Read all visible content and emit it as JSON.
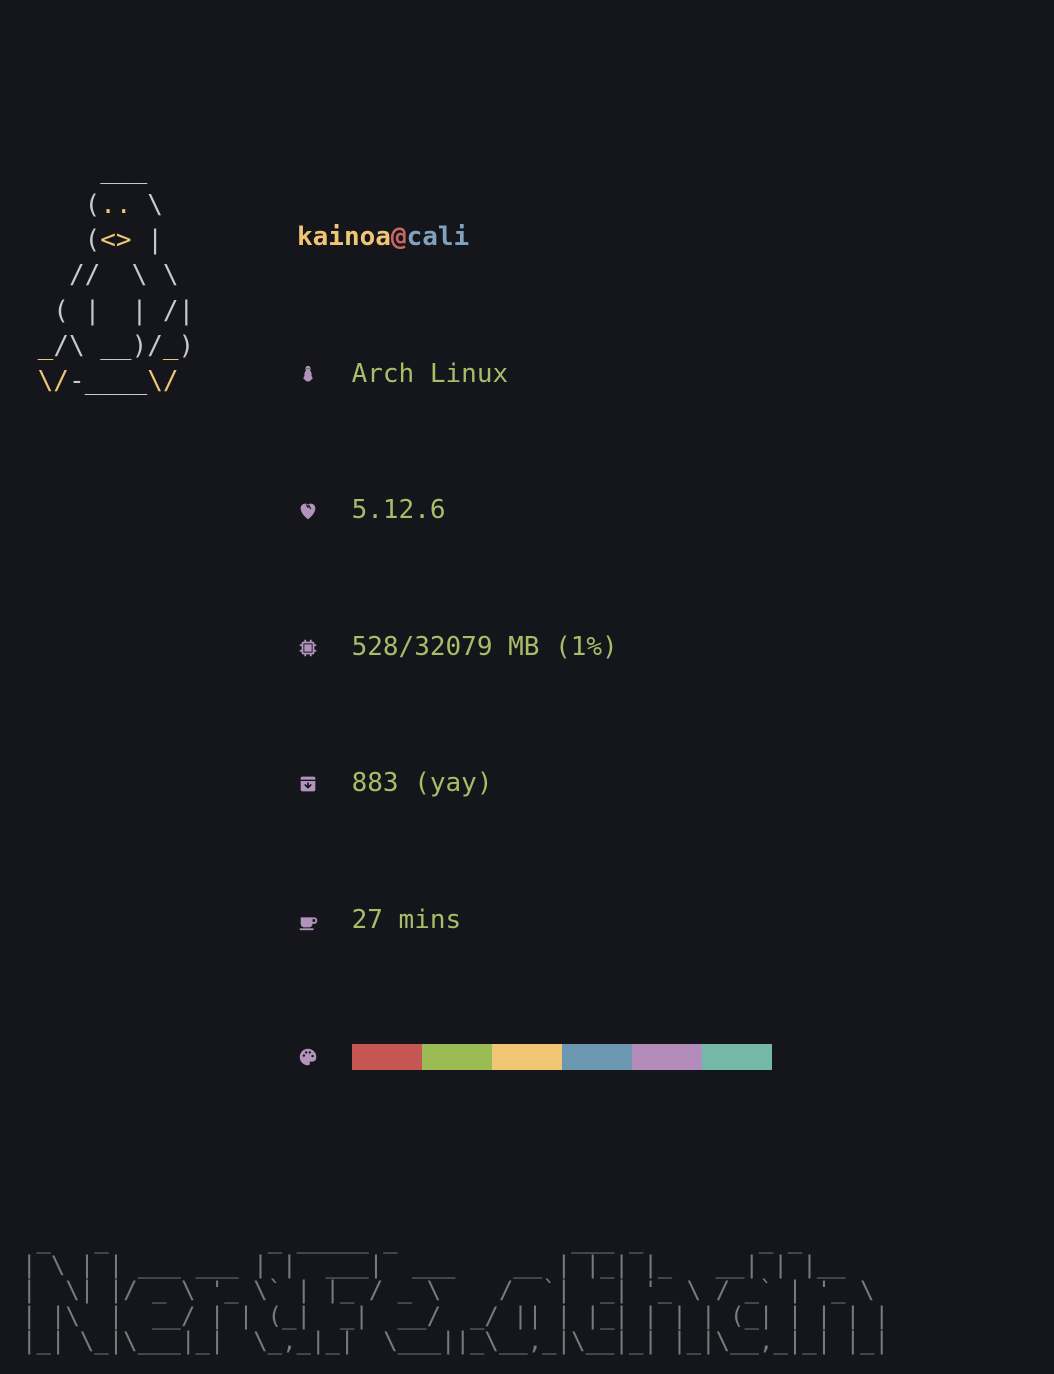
{
  "header": {
    "user": "kainoa",
    "at": "@",
    "host": "cali"
  },
  "sys": {
    "os": "Arch Linux",
    "kernel": "5.12.6",
    "memory": "528/32079 MB (1%)",
    "packages": "883 (yay)",
    "uptime": "27 mins"
  },
  "palette": [
    "#c55653",
    "#9bbb55",
    "#f0c674",
    "#6b98b0",
    "#b48cbb",
    "#74b8a9"
  ],
  "ascii_penguin": {
    "l0": "     ___       ",
    "l1": "    (",
    "l1b": ".. ",
    "l1c": "\\     ",
    "l2": "    (",
    "l2b": "<> ",
    "l2c": "|     ",
    "l3": "   //  \\ \\    ",
    "l4": "  ( |  | /|   ",
    "l5": " ",
    "l5a": "_",
    "l5b": "/\\ __)/",
    "l5c": "_",
    "l5d": ")   ",
    "l6": " ",
    "l6a": "\\/",
    "l6b": "-____",
    "l6c": "\\/",
    "l6d": "    "
  },
  "figlet": {
    "l0": " _   _           _ _____ _            ___ _        _ _ ",
    "l1": "| \\ | | ___ ___ | |  ___|  ___    __ | |_| |_   __| | |__",
    "l2": "|  \\| |/ _ \\ '_ \\` | |_ / _ \\    /  `|  _| '_ \\ / _` | '_ \\",
    "l3": "| |\\  |  __/ | | (_|  _|  __/  _/ || | |_| | | | (_| | | | |",
    "l4": "|_| \\_|\\___|_|  \\_,_|_|  \\___||_\\__,_|\\__|_| |_|\\__,_|_| |_|"
  }
}
